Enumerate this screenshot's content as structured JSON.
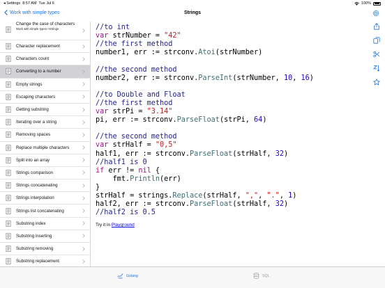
{
  "status": {
    "time": "8:57 AM",
    "date": "Tue Jul 6",
    "back_app": "◂ Settings",
    "battery": "100%"
  },
  "nav": {
    "back_label": "Work with simple types",
    "title": "Strings"
  },
  "sidebar": {
    "first_item": {
      "label": "Change the case of characters",
      "sublabel": "Work with simple types->Strings"
    },
    "items": [
      "Character replacement",
      "Characters count",
      "Converting to a number",
      "Empty strings",
      "Escaping characters",
      "Getting substring",
      "Iterating over a string",
      "Removing spaces",
      "Replace multiple characters",
      "Split into an array",
      "Strings comparison",
      "Strings concatenating",
      "Strings interpolation",
      "Strings list concatenating",
      "Substring index",
      "Substring inserting",
      "Substring removing",
      "Substring replacement"
    ],
    "selected_index": 2
  },
  "code_lines": [
    "//to int",
    "var strNumber = \"42\"",
    "//the first method",
    "number1, err := strconv.Atoi(strNumber)",
    "",
    "//the second method",
    "number2, err := strconv.ParseInt(strNumber, 10, 16)",
    "",
    "//to Double and Float",
    "//the first method",
    "var strPi = \"3.14\"",
    "pi, err := strconv.ParseFloat(strPi, 64)",
    "",
    "//the second method",
    "var strHalf = \"0,5\"",
    "half1, err := strconv.ParseFloat(strHalf, 32)",
    "//half1 is 0",
    "if err != nil {",
    "    fmt.Println(err)",
    "}",
    "strHalf = strings.Replace(strHalf, \",\", \".\", 1)",
    "half2, err := strconv.ParseFloat(strHalf, 32)",
    "//half2 is 0.5"
  ],
  "try": {
    "prefix": "Try it in",
    "link": "Playground"
  },
  "tabs": [
    {
      "label": "Golang",
      "active": true
    },
    {
      "label": "SQL",
      "active": false
    }
  ],
  "colors": {
    "accent": "#1a73e8",
    "selected_row": "#d1d1d6",
    "keyword": "#a90d91",
    "comment": "#23238b",
    "string": "#c41a16",
    "number": "#1c00cf"
  }
}
